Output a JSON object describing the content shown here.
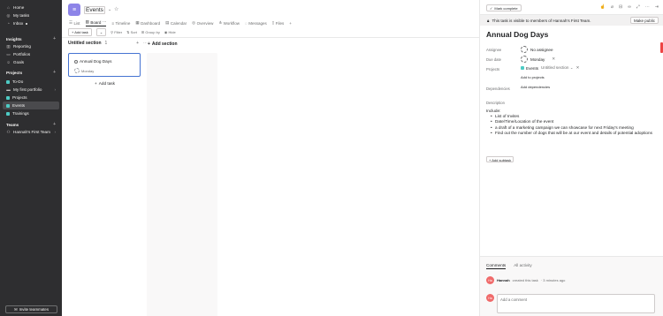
{
  "sidebar": {
    "nav": [
      {
        "label": "Home",
        "icon": "home-icon"
      },
      {
        "label": "My tasks",
        "icon": "check-circle-icon"
      },
      {
        "label": "Inbox",
        "icon": "bell-icon"
      }
    ],
    "insights_label": "Insights",
    "insights": [
      {
        "label": "Reporting"
      },
      {
        "label": "Portfolios"
      },
      {
        "label": "Goals"
      }
    ],
    "projects_label": "Projects",
    "projects": [
      {
        "label": "To-Do",
        "color": "#4ecbc4"
      },
      {
        "label": "My first portfolio",
        "color": "#9c9c9c"
      },
      {
        "label": "Projects",
        "color": "#4ecbc4"
      },
      {
        "label": "Events",
        "color": "#4ecbc4"
      },
      {
        "label": "Trainings",
        "color": "#4ecbc4"
      }
    ],
    "teams_label": "Teams",
    "team": {
      "label": "Hannah's First Team"
    },
    "invite_label": "Invite teammates"
  },
  "project": {
    "title": "Events",
    "tabs": [
      {
        "label": "List"
      },
      {
        "label": "Board"
      },
      {
        "label": "Timeline"
      },
      {
        "label": "Dashboard"
      },
      {
        "label": "Calendar"
      },
      {
        "label": "Overview"
      },
      {
        "label": "Workflow"
      },
      {
        "label": "Messages"
      },
      {
        "label": "Files"
      }
    ],
    "toolbar": {
      "add_task": "Add task",
      "filter": "Filter",
      "sort": "Sort",
      "group_by": "Group by",
      "hide": "Hide"
    }
  },
  "board": {
    "section_title": "Untitled section",
    "section_count": "1",
    "add_section": "Add section",
    "card": {
      "title": "Annual Dog Days",
      "date": "Monday"
    },
    "add_task": "Add task"
  },
  "panel": {
    "mark_complete": "Mark complete",
    "visibility": "This task is visible to members of Hannah's First Team.",
    "make_public": "Make public",
    "task_title": "Annual Dog Days",
    "assignee_label": "Assignee",
    "assignee_value": "No assignee",
    "due_label": "Due date",
    "due_value": "Monday",
    "projects_label": "Projects",
    "project_name": "Events",
    "project_section": "Untitled section",
    "add_to_projects": "Add to projects",
    "dependencies_label": "Dependencies",
    "add_dependencies": "Add dependencies",
    "description_label": "Description",
    "description_intro": "Include:",
    "description_items": [
      "List of Invites",
      "Date/Time/Location of the event",
      "a draft of a marketing campaign we can showcase for next Friday's meeting",
      "Find out the number of dogs that will be at our event and details of potential adoptions"
    ],
    "add_subtask": "Add subtask",
    "comments_tab": "Comments",
    "activity_tab": "All activity",
    "activity_user": "Hannah",
    "activity_text": "created this task",
    "activity_time": "· 3 minutes ago",
    "avatar_initials": "Ha",
    "comment_placeholder": "Add a comment"
  }
}
